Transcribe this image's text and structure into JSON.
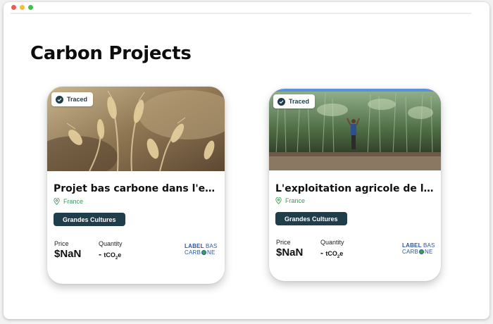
{
  "page": {
    "title": "Carbon Projects"
  },
  "colors": {
    "accent": "#1f3d4a",
    "location": "#3b9a5b",
    "logo": "#2c58a0"
  },
  "projects": [
    {
      "badge": "Traced",
      "title": "Projet bas carbone dans l'exploi...",
      "location": "France",
      "category": "Grandes Cultures",
      "price_label": "Price",
      "price_value": "$NaN",
      "quantity_label": "Quantity",
      "quantity_value": "-",
      "quantity_unit": "tCO",
      "quantity_unit_sub": "2",
      "quantity_unit_suffix": "e",
      "logo_line1_bold": "LABEL",
      "logo_line1_thin": "BAS",
      "logo_line2_a": "CARB",
      "logo_line2_b": "NE",
      "image": "wheat-field"
    },
    {
      "badge": "Traced",
      "title": "L'exploitation agricole de la fam...",
      "location": "France",
      "category": "Grandes Cultures",
      "price_label": "Price",
      "price_value": "$NaN",
      "quantity_label": "Quantity",
      "quantity_value": "-",
      "quantity_unit": "tCO",
      "quantity_unit_sub": "2",
      "quantity_unit_suffix": "e",
      "logo_line1_bold": "LABEL",
      "logo_line1_thin": "BAS",
      "logo_line2_a": "CARB",
      "logo_line2_b": "NE",
      "image": "tall-crop-with-person"
    }
  ]
}
